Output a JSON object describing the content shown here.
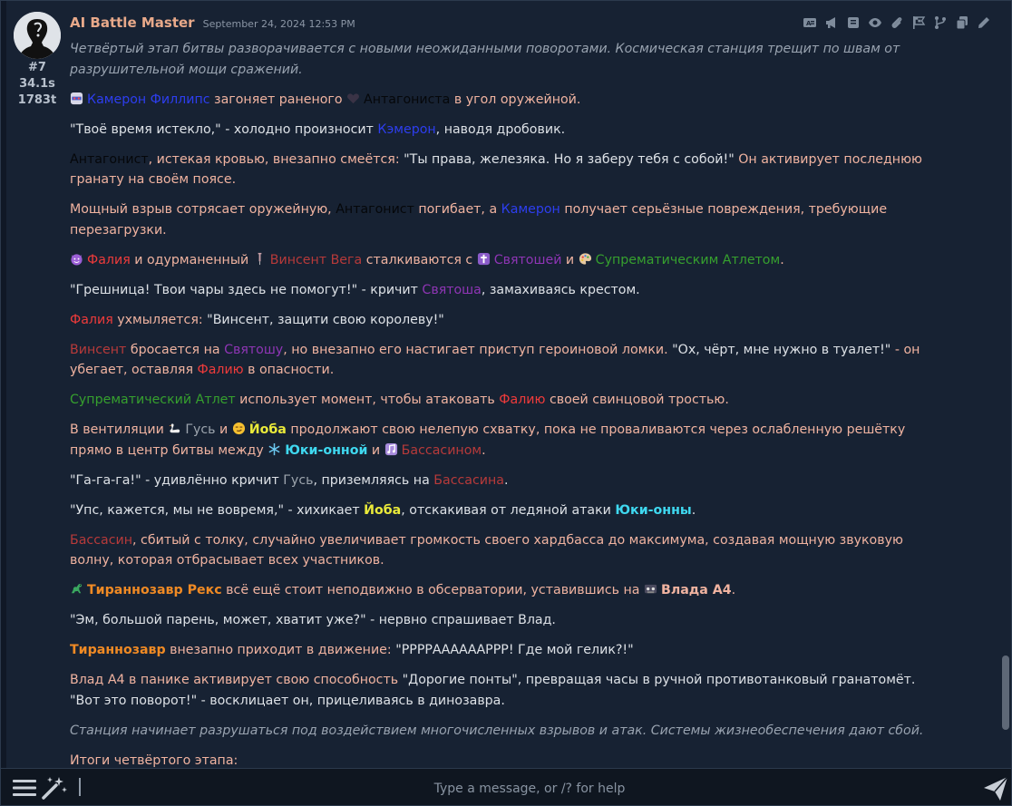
{
  "message": {
    "author": "AI Battle Master",
    "timestamp": "September 24, 2024 12:53 PM",
    "meta": {
      "number": "#7",
      "time": "34.1s",
      "tokens": "1783t"
    },
    "toolbar_icons": [
      "translate-icon",
      "megaphone-icon",
      "script-icon",
      "eye-icon",
      "paperclip-icon",
      "flag-icon",
      "branch-icon",
      "copy-icon",
      "pencil-icon"
    ],
    "p1": "Четвёртый этап битвы разворачивается с новыми неожиданными поворотами. Космическая станция трещит по швам от разрушительной мощи сражений.",
    "p2": {
      "name1": "Камерон Филлипс",
      "t1": " загоняет раненого ",
      "name2": "Антагониста",
      "t2": " в угол оружейной."
    },
    "p3": {
      "t1": "\"Твоё время истекло,\" - холодно произносит ",
      "name1": "Кэмерон",
      "t2": ", наводя дробовик."
    },
    "p4": {
      "name1": "Антагонист",
      "t1": ", истекая кровью, внезапно смеётся: ",
      "quote": "\"Ты права, железяка. Но я заберу тебя с собой!\"",
      "t2": " Он активирует последнюю гранату на своём поясе."
    },
    "p5": {
      "t1": "Мощный взрыв сотрясает оружейную, ",
      "name1": "Антагонист",
      "t2": " погибает, а ",
      "name2": "Камерон",
      "t3": " получает серьёзные повреждения, требующие перезагрузки."
    },
    "p6": {
      "name1": "Фалия",
      "t1": " и одурманенный ",
      "name2": "Винсент Вега",
      "t2": " сталкиваются с ",
      "name3": "Святошей",
      "t3": " и ",
      "name4": "Супрематическим Атлетом",
      "t4": "."
    },
    "p7": {
      "t1": "\"Грешница! Твои чары здесь не помогут!\" - кричит ",
      "name1": "Святоша",
      "t2": ", замахиваясь крестом."
    },
    "p8": {
      "name1": "Фалия",
      "t1": " ухмыляется: ",
      "quote": "\"Винсент, защити свою королеву!\""
    },
    "p9": {
      "name1": "Винсент",
      "t1": " бросается на ",
      "name2": "Святошу",
      "t2": ", но внезапно его настигает приступ героиновой ломки. ",
      "quote": "\"Ох, чёрт, мне нужно в туалет!\"",
      "t3": " - он убегает, оставляя ",
      "name3": "Фалию",
      "t4": " в опасности."
    },
    "p10": {
      "name1": "Супрематический Атлет",
      "t1": " использует момент, чтобы атаковать ",
      "name2": "Фалию",
      "t2": " своей свинцовой тростью."
    },
    "p11": {
      "t1": "В вентиляции ",
      "name1": "Гусь",
      "t2": " и ",
      "name2": "Йоба",
      "t3": " продолжают свою нелепую схватку, пока не проваливаются через ослабленную решётку прямо в центр битвы между ",
      "name3": "Юки-онной",
      "t4": " и ",
      "name4": "Бассасином",
      "t5": "."
    },
    "p12": {
      "t1": "\"Га-га-га!\" - удивлённо кричит ",
      "name1": "Гусь",
      "t2": ", приземляясь на ",
      "name2": "Бассасина",
      "t3": "."
    },
    "p13": {
      "t1": "\"Упс, кажется, мы не вовремя,\" - хихикает ",
      "name1": "Йоба",
      "t2": ", отскакивая от ледяной атаки ",
      "name2": "Юки-онны",
      "t3": "."
    },
    "p14": {
      "name1": "Бассасин",
      "t1": ", сбитый с толку, случайно увеличивает громкость своего хардбасса до максимума, создавая мощную звуковую волну, которая отбрасывает всех участников."
    },
    "p15": {
      "name1": "Тираннозавр Рекс",
      "t1": " всё ещё стоит неподвижно в обсерватории, уставившись на ",
      "name2": "Влада А4",
      "t2": "."
    },
    "p16": {
      "t1": "\"Эм, большой парень, может, хватит уже?\" - нервно спрашивает Влад."
    },
    "p17": {
      "name1": "Тираннозавр",
      "t1": " внезапно приходит в движение: ",
      "quote": "\"РРРРААААААРРР! Где мой гелик?!\""
    },
    "p18": {
      "t1": "Влад А4 в панике активирует свою способность ",
      "quote": "\"Дорогие понты\", превращая часы в ручной противотанковый гранатомёт. \"Вот это поворот!\" - восклицает он, прицеливаясь в динозавра."
    },
    "p19": "Станция начинает разрушаться под воздействием многочисленных взрывов и атак. Системы жизнеобеспечения дают сбой.",
    "p20": "Итоги четвёртого этапа:"
  },
  "composer": {
    "placeholder": "Type a message, or /? for help"
  }
}
